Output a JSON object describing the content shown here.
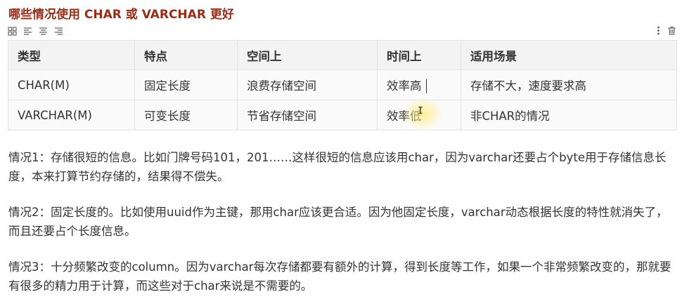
{
  "doc": {
    "title": "哪些情况使用 CHAR 或 VARCHAR 更好",
    "toolbar_left_icons": [
      "grid-icon",
      "align-left-icon",
      "align-center-icon",
      "align-right-icon"
    ],
    "toolbar_right_icons": [
      "more-vertical-icon",
      "trash-icon"
    ]
  },
  "table": {
    "headers": [
      "类型",
      "特点",
      "空间上",
      "时间上",
      "适用场景"
    ],
    "rows": [
      [
        "CHAR(M)",
        "固定长度",
        "浪费存储空间",
        "效率高",
        "存储不大，速度要求高"
      ],
      [
        "VARCHAR(M)",
        "可变长度",
        "节省存储空间",
        "效率低",
        "非CHAR的情况"
      ]
    ]
  },
  "paragraphs": [
    "情况1：存储很短的信息。比如门牌号码101，201……这样很短的信息应该用char，因为varchar还要占个byte用于存储信息长度，本来打算节约存储的，结果得不偿失。",
    "情况2：固定长度的。比如使用uuid作为主键，那用char应该更合适。因为他固定长度，varchar动态根据长度的特性就消失了，而且还要占个长度信息。",
    "情况3：十分频繁改变的column。因为varchar每次存储都要有额外的计算，得到长度等工作，如果一个非常频繁改变的，那就要有很多的精力用于计算，而这些对于char来说是不需要的。"
  ],
  "colors": {
    "title": "#9a2b16",
    "header_bg": "#f3f3f3",
    "cell_bg": "#fafafa",
    "border": "#e2e2e2"
  }
}
